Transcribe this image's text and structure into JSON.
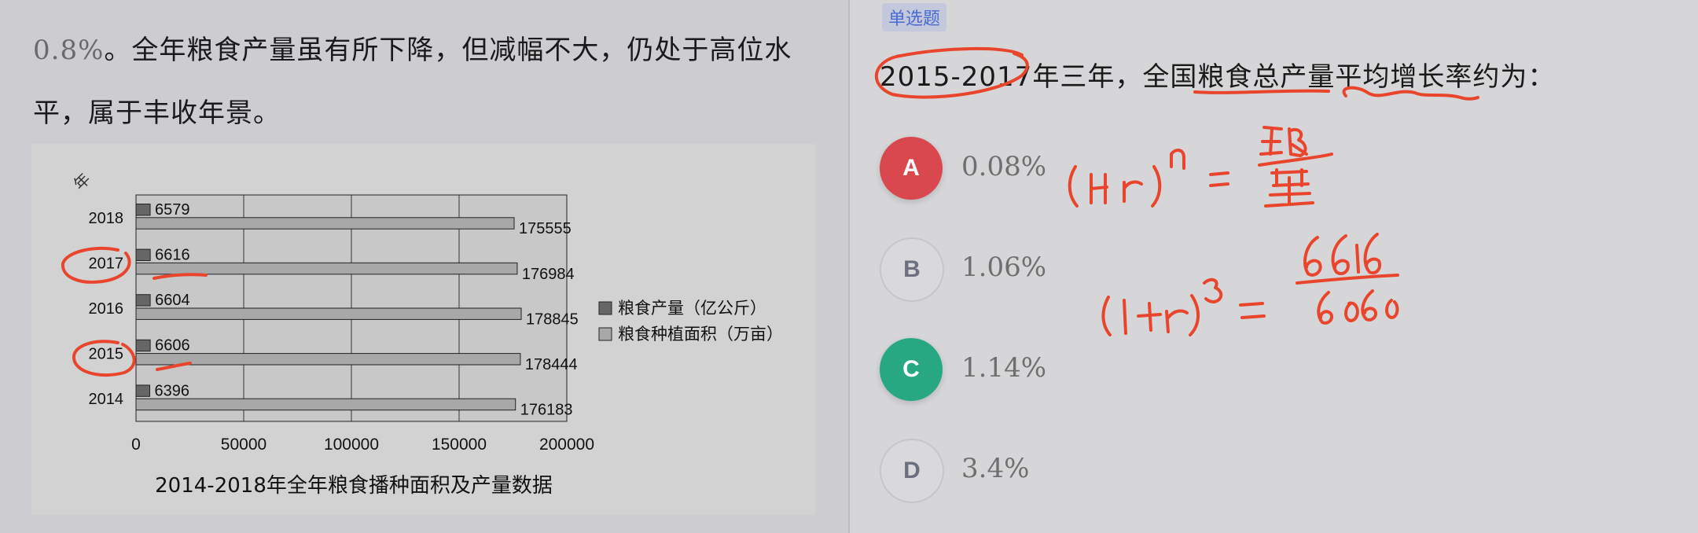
{
  "passage": {
    "line1_num": "0.8%",
    "line1_rest": "。全年粮食产量虽有所下降，但减幅不大，仍处于高位水",
    "line2": "平，属于丰收年景。"
  },
  "chart_data": {
    "type": "bar",
    "orientation": "horizontal",
    "title": "2014-2018年全年粮食播种面积及产量数据",
    "ylabel": "年",
    "categories": [
      "2014",
      "2015",
      "2016",
      "2017",
      "2018"
    ],
    "series": [
      {
        "name": "粮食产量（亿公斤）",
        "values": [
          6396,
          6606,
          6604,
          6616,
          6579
        ],
        "color": "#666666"
      },
      {
        "name": "粮食种植面积（万亩）",
        "values": [
          176183,
          178444,
          178845,
          176984,
          175555
        ],
        "color": "#a8a8a8"
      }
    ],
    "xlim": [
      0,
      200000
    ],
    "xticks": [
      "0",
      "50000",
      "100000",
      "150000",
      "200000"
    ],
    "grid": true,
    "legend_position": "right"
  },
  "question": {
    "type_tag": "单选题",
    "text": "2015-2017年三年，全国粮食总产量平均增长率约为："
  },
  "options": [
    {
      "letter": "A",
      "text": "0.08%",
      "state": "wrong"
    },
    {
      "letter": "B",
      "text": "1.06%",
      "state": "normal"
    },
    {
      "letter": "C",
      "text": "1.14%",
      "state": "correct"
    },
    {
      "letter": "D",
      "text": "3.4%",
      "state": "normal"
    }
  ],
  "colors": {
    "wrong": "#d9484e",
    "correct": "#27a883",
    "annotation": "#e8452c",
    "tag_text": "#4a6bd0"
  }
}
